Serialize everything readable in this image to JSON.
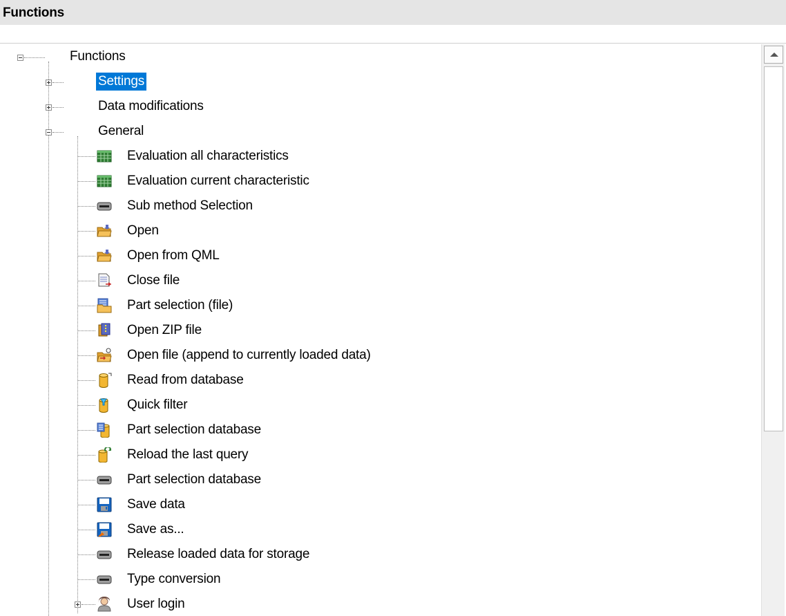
{
  "panel": {
    "title": "Functions"
  },
  "tree": {
    "root": {
      "label": "Functions",
      "expanded": true
    },
    "children": [
      {
        "label": "Settings",
        "expanded": false,
        "selected": true
      },
      {
        "label": "Data modifications",
        "expanded": false
      },
      {
        "label": "General",
        "expanded": true,
        "items": [
          {
            "label": "Evaluation all characteristics",
            "icon": "table-grid-icon"
          },
          {
            "label": "Evaluation current characteristic",
            "icon": "table-grid-icon"
          },
          {
            "label": "Sub method Selection",
            "icon": "button-icon"
          },
          {
            "label": "Open",
            "icon": "folder-open-icon"
          },
          {
            "label": "Open from QML",
            "icon": "folder-open-icon"
          },
          {
            "label": "Close file",
            "icon": "document-close-icon"
          },
          {
            "label": "Part selection (file)",
            "icon": "folder-list-icon"
          },
          {
            "label": "Open ZIP file",
            "icon": "zip-file-icon"
          },
          {
            "label": "Open file (append to currently loaded data)",
            "icon": "folder-append-icon"
          },
          {
            "label": "Read from database",
            "icon": "database-icon"
          },
          {
            "label": "Quick filter",
            "icon": "database-filter-icon"
          },
          {
            "label": "Part selection database",
            "icon": "database-list-icon"
          },
          {
            "label": "Reload the last query",
            "icon": "database-reload-icon"
          },
          {
            "label": "Part selection database",
            "icon": "button-icon"
          },
          {
            "label": "Save data",
            "icon": "floppy-disk-icon"
          },
          {
            "label": "Save as...",
            "icon": "save-as-icon"
          },
          {
            "label": "Release loaded data for storage",
            "icon": "button-icon"
          },
          {
            "label": "Type conversion",
            "icon": "button-icon"
          },
          {
            "label": "User login",
            "icon": "user-icon",
            "expandable": true
          }
        ]
      }
    ]
  },
  "colors": {
    "selection": "#0078d7",
    "header_bg": "#e5e5e5",
    "scrollbar_bg": "#f0f0f0"
  }
}
